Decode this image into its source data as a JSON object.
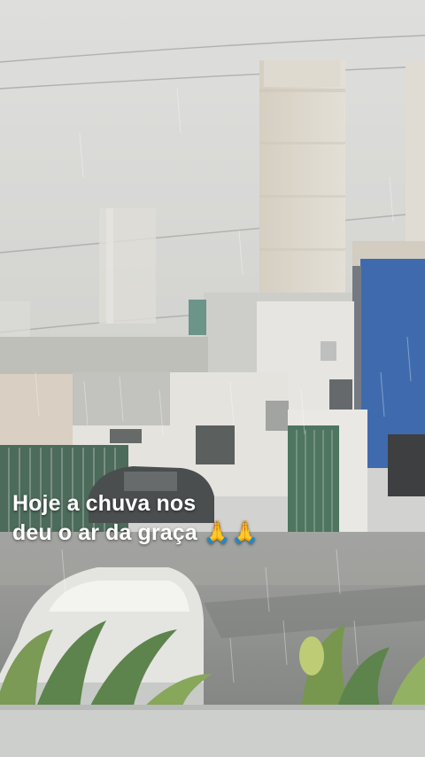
{
  "story": {
    "caption_line1": "Hoje a chuva nos",
    "caption_line2": "deu o ar da graça",
    "caption_emoji": "🙏🙏"
  },
  "colors": {
    "sky": "#d6d6d4",
    "building_blue": "#2f5fa8",
    "tower": "#d8d2c6",
    "street": "#8c8e8b"
  }
}
